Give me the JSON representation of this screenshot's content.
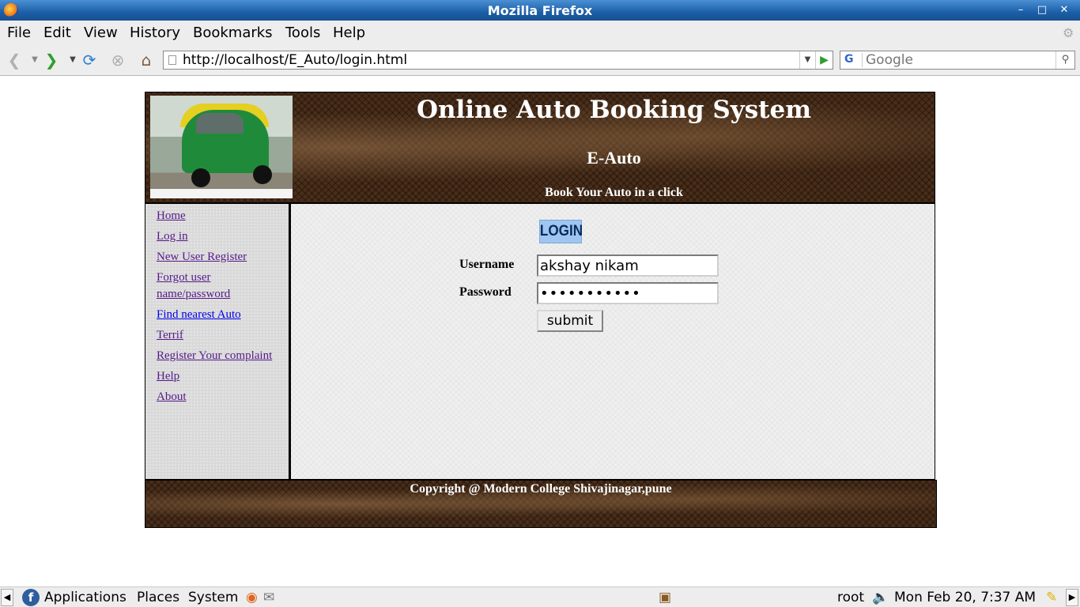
{
  "window": {
    "title": "Mozilla Firefox"
  },
  "menubar": {
    "items": [
      {
        "label": "File"
      },
      {
        "label": "Edit"
      },
      {
        "label": "View"
      },
      {
        "label": "History"
      },
      {
        "label": "Bookmarks"
      },
      {
        "label": "Tools"
      },
      {
        "label": "Help"
      }
    ]
  },
  "toolbar": {
    "url": "http://localhost/E_Auto/login.html",
    "search_placeholder": "Google",
    "search_engine": "G"
  },
  "header": {
    "title": "Online Auto Booking System",
    "subtitle": "E-Auto",
    "tagline": "Book Your Auto in a click"
  },
  "sidebar": {
    "links": [
      {
        "label": "Home"
      },
      {
        "label": "Log in"
      },
      {
        "label": "New User Register"
      },
      {
        "label": "Forgot user name/password"
      },
      {
        "label": "Find nearest Auto"
      },
      {
        "label": "Terrif"
      },
      {
        "label": "Register Your complaint"
      },
      {
        "label": "Help"
      },
      {
        "label": "About"
      }
    ]
  },
  "login": {
    "badge": "LOGIN",
    "username_label": "Username",
    "username_value": "akshay nikam",
    "password_label": "Password",
    "password_value": "•••••••••••",
    "submit_label": "submit"
  },
  "footer": {
    "copyright": "Copyright @ Modern College Shivajinagar,pune"
  },
  "panel": {
    "applications": "Applications",
    "places": "Places",
    "system": "System",
    "user": "root",
    "datetime": "Mon Feb 20,  7:37 AM"
  },
  "colors": {
    "titlebar": "#1c5fa8",
    "header_bg": "#4a2e1a",
    "visited_link": "#551a8b",
    "link": "#0000ee"
  }
}
